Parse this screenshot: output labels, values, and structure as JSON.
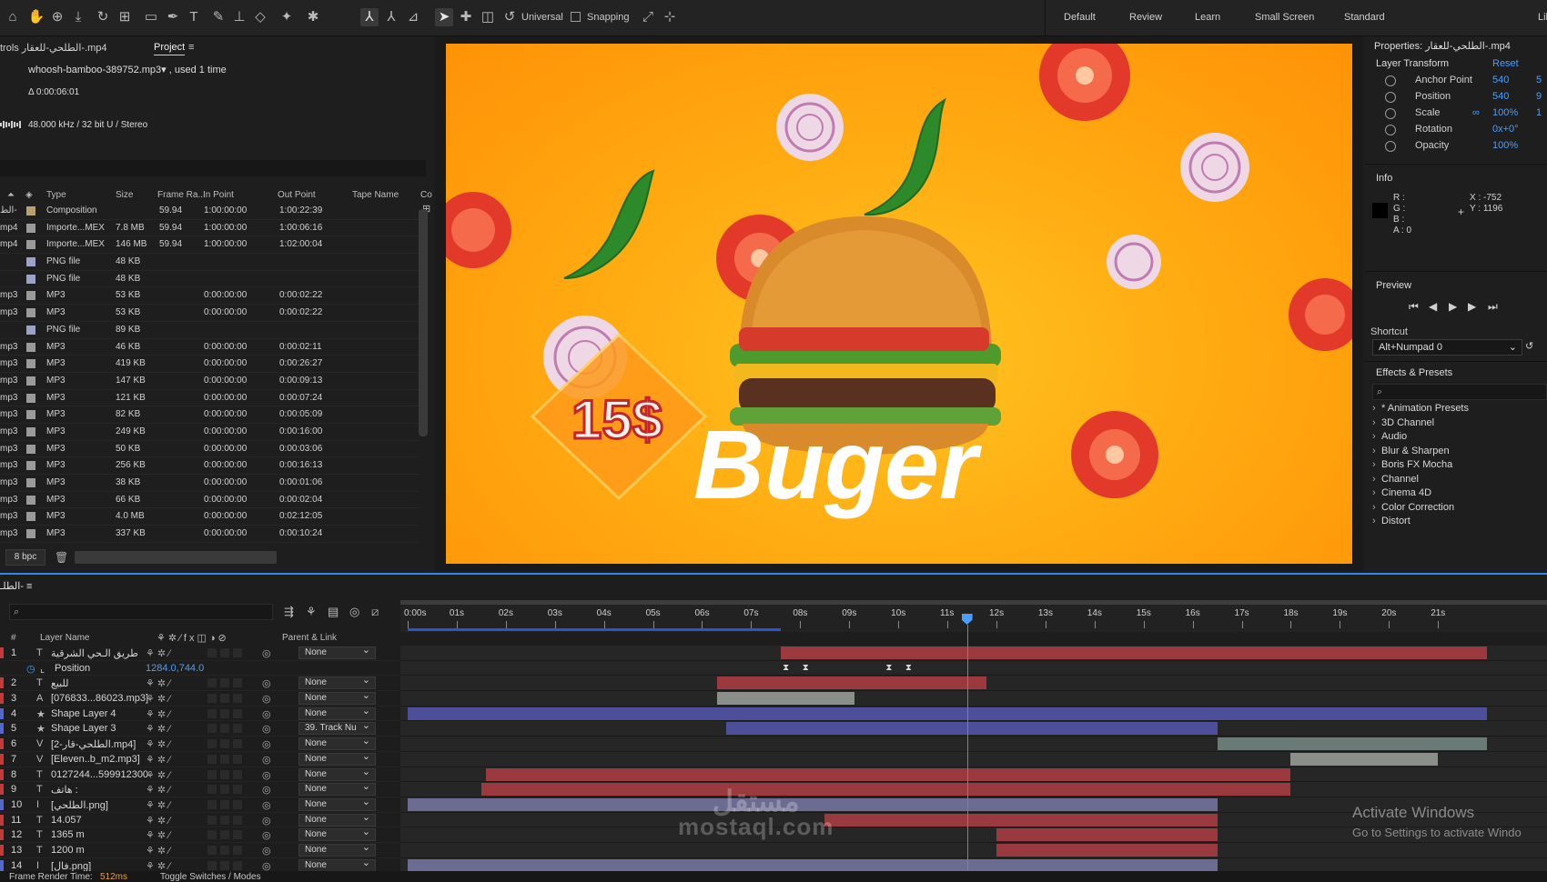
{
  "toolbar": {
    "universal_label": "Universal",
    "snapping_label": "Snapping",
    "workspaces": [
      "Default",
      "Review",
      "Learn",
      "Small Screen",
      "Standard",
      "Lib"
    ]
  },
  "project": {
    "tab_controls": "trols الطلحي-للعقار-.mp4",
    "tab_project": "Project",
    "file_name": "whoosh-bamboo-389752.mp3",
    "used": ", used 1 time",
    "duration": "Δ 0:00:06:01",
    "audio_info": "48.000 kHz / 32 bit U / Stereo",
    "columns": [
      "Type",
      "Size",
      "Frame Ra...",
      "In Point",
      "Out Point",
      "Tape Name",
      "Co"
    ],
    "bpc": "8 bpc",
    "rows": [
      {
        "name": "الط-",
        "color": "#b8a070",
        "type": "Composition",
        "size": "",
        "fps": "59.94",
        "in": "1:00:00:00",
        "out": "1:00:22:39"
      },
      {
        "name": "mp4",
        "color": "#9a9a9a",
        "type": "Importe...MEX",
        "size": "7.8 MB",
        "fps": "59.94",
        "in": "1:00:00:00",
        "out": "1:00:06:16"
      },
      {
        "name": "mp4",
        "color": "#9a9a9a",
        "type": "Importe...MEX",
        "size": "146 MB",
        "fps": "59.94",
        "in": "1:00:00:00",
        "out": "1:02:00:04"
      },
      {
        "name": "",
        "color": "#9aa2c8",
        "type": "PNG file",
        "size": "48 KB",
        "fps": "",
        "in": "",
        "out": ""
      },
      {
        "name": "",
        "color": "#9aa2c8",
        "type": "PNG file",
        "size": "48 KB",
        "fps": "",
        "in": "",
        "out": ""
      },
      {
        "name": "mp3",
        "color": "#9a9a9a",
        "type": "MP3",
        "size": "53 KB",
        "fps": "",
        "in": "0:00:00:00",
        "out": "0:00:02:22"
      },
      {
        "name": "mp3",
        "color": "#9a9a9a",
        "type": "MP3",
        "size": "53 KB",
        "fps": "",
        "in": "0:00:00:00",
        "out": "0:00:02:22"
      },
      {
        "name": "",
        "color": "#9aa2c8",
        "type": "PNG file",
        "size": "89 KB",
        "fps": "",
        "in": "",
        "out": ""
      },
      {
        "name": "mp3",
        "color": "#9a9a9a",
        "type": "MP3",
        "size": "46 KB",
        "fps": "",
        "in": "0:00:00:00",
        "out": "0:00:02:11"
      },
      {
        "name": "mp3",
        "color": "#9a9a9a",
        "type": "MP3",
        "size": "419 KB",
        "fps": "",
        "in": "0:00:00:00",
        "out": "0:00:26:27"
      },
      {
        "name": "mp3",
        "color": "#9a9a9a",
        "type": "MP3",
        "size": "147 KB",
        "fps": "",
        "in": "0:00:00:00",
        "out": "0:00:09:13"
      },
      {
        "name": "mp3",
        "color": "#9a9a9a",
        "type": "MP3",
        "size": "121 KB",
        "fps": "",
        "in": "0:00:00:00",
        "out": "0:00:07:24"
      },
      {
        "name": "mp3",
        "color": "#9a9a9a",
        "type": "MP3",
        "size": "82 KB",
        "fps": "",
        "in": "0:00:00:00",
        "out": "0:00:05:09"
      },
      {
        "name": "mp3",
        "color": "#9a9a9a",
        "type": "MP3",
        "size": "249 KB",
        "fps": "",
        "in": "0:00:00:00",
        "out": "0:00:16:00"
      },
      {
        "name": "mp3",
        "color": "#9a9a9a",
        "type": "MP3",
        "size": "50 KB",
        "fps": "",
        "in": "0:00:00:00",
        "out": "0:00:03:06"
      },
      {
        "name": "mp3",
        "color": "#9a9a9a",
        "type": "MP3",
        "size": "256 KB",
        "fps": "",
        "in": "0:00:00:00",
        "out": "0:00:16:13"
      },
      {
        "name": "mp3",
        "color": "#9a9a9a",
        "type": "MP3",
        "size": "38 KB",
        "fps": "",
        "in": "0:00:00:00",
        "out": "0:00:01:06"
      },
      {
        "name": "mp3",
        "color": "#9a9a9a",
        "type": "MP3",
        "size": "66 KB",
        "fps": "",
        "in": "0:00:00:00",
        "out": "0:00:02:04"
      },
      {
        "name": "mp3",
        "color": "#9a9a9a",
        "type": "MP3",
        "size": "4.0 MB",
        "fps": "",
        "in": "0:00:00:00",
        "out": "0:02:12:05"
      },
      {
        "name": "mp3",
        "color": "#9a9a9a",
        "type": "MP3",
        "size": "337 KB",
        "fps": "",
        "in": "0:00:00:00",
        "out": "0:00:10:24"
      }
    ]
  },
  "viewer": {
    "price_text": "15$",
    "burger_text": "Buger",
    "bg_color": "#ffa80f"
  },
  "properties": {
    "title": "Properties: الطلحي-للعقار-.mp4",
    "section": "Layer Transform",
    "reset": "Reset",
    "props": [
      {
        "name": "Anchor Point",
        "value": "540",
        "value2": "5"
      },
      {
        "name": "Position",
        "value": "540",
        "value2": "9"
      },
      {
        "name": "Scale",
        "value": "100%",
        "value2": "1"
      },
      {
        "name": "Rotation",
        "value": "0x+0°",
        "value2": ""
      },
      {
        "name": "Opacity",
        "value": "100%",
        "value2": ""
      }
    ]
  },
  "info": {
    "title": "Info",
    "r": "R :",
    "g": "G :",
    "b": "B :",
    "a": "A :  0",
    "x": "X : -752",
    "y": "Y : 1196"
  },
  "preview": {
    "title": "Preview"
  },
  "shortcut": {
    "title": "Shortcut",
    "value": "Alt+Numpad 0"
  },
  "effects": {
    "title": "Effects & Presets",
    "items": [
      "* Animation Presets",
      "3D Channel",
      "Audio",
      "Blur & Sharpen",
      "Boris FX Mocha",
      "Channel",
      "Cinema 4D",
      "Color Correction",
      "Distort"
    ]
  },
  "timeline": {
    "tab": "الطلـ-",
    "col_num": "#",
    "col_name": "Layer Name",
    "col_parent": "Parent & Link",
    "ruler": [
      "0:00s",
      "01s",
      "02s",
      "03s",
      "04s",
      "05s",
      "06s",
      "07s",
      "08s",
      "09s",
      "10s",
      "11s",
      "12s",
      "13s",
      "14s",
      "15s",
      "16s",
      "17s",
      "18s",
      "19s",
      "20s",
      "21s"
    ],
    "current_time_s": 11.4,
    "position_value": "1284.0,744.0",
    "layers": [
      {
        "num": "1",
        "label": "#c23a3a",
        "kind": "T",
        "name": "طريق الـحي الشرقية",
        "parent": "None",
        "bar": {
          "start": 7.6,
          "end": 22,
          "color": "#9b3a3e"
        }
      },
      {
        "num": "",
        "label": "",
        "kind": "",
        "name": "Position",
        "parent": "",
        "sub": true
      },
      {
        "num": "2",
        "label": "#c23a3a",
        "kind": "T",
        "name": "للبيع",
        "parent": "None",
        "bar": {
          "start": 6.3,
          "end": 11.8,
          "color": "#9b3a3e"
        }
      },
      {
        "num": "3",
        "label": "#c23a3a",
        "kind": "A",
        "name": "[076833...86023.mp3]",
        "parent": "None",
        "bar": {
          "start": 6.3,
          "end": 9.1,
          "color": "#8a8f8a"
        }
      },
      {
        "num": "4",
        "label": "#5566cc",
        "kind": "★",
        "name": "Shape Layer 4",
        "parent": "None",
        "bar": {
          "start": 0,
          "end": 22,
          "color": "#4e4f9a"
        }
      },
      {
        "num": "5",
        "label": "#5566cc",
        "kind": "★",
        "name": "Shape Layer 3",
        "parent": "39. Track Nu",
        "bar": {
          "start": 6.5,
          "end": 16.5,
          "color": "#4e4f9a"
        }
      },
      {
        "num": "6",
        "label": "#c23a3a",
        "kind": "V",
        "name": "[2-الطلحي-قار.mp4]",
        "parent": "None",
        "bar": {
          "start": 16.5,
          "end": 22,
          "color": "#6a7a76"
        }
      },
      {
        "num": "7",
        "label": "#c23a3a",
        "kind": "V",
        "name": "[Eleven..b_m2.mp3]",
        "parent": "None",
        "bar": {
          "start": 18,
          "end": 21,
          "color": "#8a8f8a"
        }
      },
      {
        "num": "8",
        "label": "#c23a3a",
        "kind": "T",
        "name": "0127244...599912300",
        "parent": "None",
        "bar": {
          "start": 1.6,
          "end": 18,
          "color": "#9b3a3e"
        }
      },
      {
        "num": "9",
        "label": "#c23a3a",
        "kind": "T",
        "name": "هاتف :",
        "parent": "None",
        "bar": {
          "start": 1.5,
          "end": 18,
          "color": "#9b3a3e"
        }
      },
      {
        "num": "10",
        "label": "#5566cc",
        "kind": "I",
        "name": "[الطلحي.png]",
        "parent": "None",
        "bar": {
          "start": 0,
          "end": 16.5,
          "color": "#6c6c92"
        }
      },
      {
        "num": "11",
        "label": "#c23a3a",
        "kind": "T",
        "name": "14.057",
        "parent": "None",
        "bar": {
          "start": 8.5,
          "end": 16.5,
          "color": "#9b3a3e"
        }
      },
      {
        "num": "12",
        "label": "#c23a3a",
        "kind": "T",
        "name": "1365 m",
        "parent": "None",
        "bar": {
          "start": 12,
          "end": 16.5,
          "color": "#9b3a3e"
        }
      },
      {
        "num": "13",
        "label": "#c23a3a",
        "kind": "T",
        "name": "1200 m",
        "parent": "None",
        "bar": {
          "start": 12,
          "end": 16.5,
          "color": "#9b3a3e"
        }
      },
      {
        "num": "14",
        "label": "#5566cc",
        "kind": "I",
        "name": "[فال.png]",
        "parent": "None",
        "bar": {
          "start": 0,
          "end": 16.5,
          "color": "#6c6c92"
        }
      }
    ],
    "footer_render": "Frame Render Time:",
    "footer_render_value": "512ms",
    "footer_toggle": "Toggle Switches / Modes"
  },
  "overlay": {
    "watermark": "مستقل\nmostaql.com",
    "watermark_1": "مستقل",
    "watermark_2": "mostaql.com",
    "activate_title": "Activate Windows",
    "activate_sub": "Go to Settings to activate Windo"
  }
}
